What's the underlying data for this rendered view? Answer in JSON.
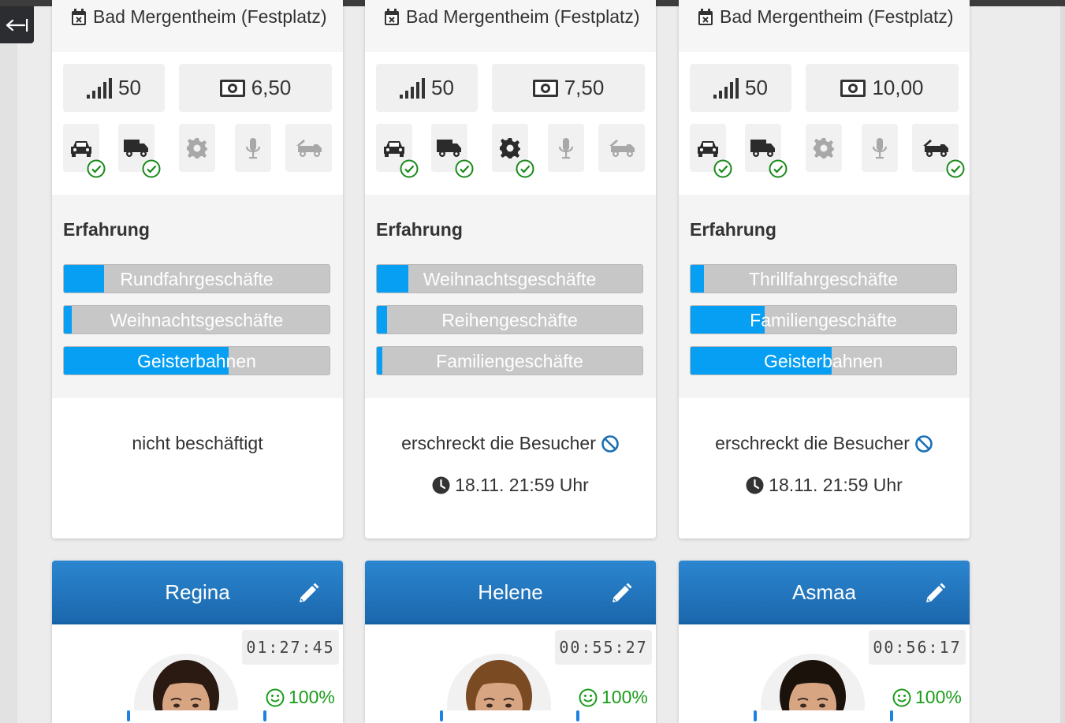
{
  "nav": {
    "back_icon": "arrow-left-bar-icon"
  },
  "cards": [
    {
      "location": "Bad Mergentheim (Festplatz)",
      "level": "50",
      "price": "6,50",
      "vehicles": {
        "car": true,
        "truck": true,
        "gear": false,
        "mic": false,
        "tow": false
      },
      "experience_title": "Erfahrung",
      "skills": [
        {
          "label": "Rundfahrgeschäfte",
          "level": 0.15
        },
        {
          "label": "Weihnachtsgeschäfte",
          "level": 0.03
        },
        {
          "label": "Geisterbahnen",
          "level": 0.62
        }
      ],
      "status": "nicht beschäftigt",
      "time": ""
    },
    {
      "location": "Bad Mergentheim (Festplatz)",
      "level": "50",
      "price": "7,50",
      "vehicles": {
        "car": true,
        "truck": true,
        "gear": true,
        "mic": false,
        "tow": false
      },
      "experience_title": "Erfahrung",
      "skills": [
        {
          "label": "Weihnachtsgeschäfte",
          "level": 0.12
        },
        {
          "label": "Reihengeschäfte",
          "level": 0.04
        },
        {
          "label": "Familiengeschäfte",
          "level": 0.02
        }
      ],
      "status": "erschreckt die Besucher",
      "time": "18.11. 21:59 Uhr"
    },
    {
      "location": "Bad Mergentheim (Festplatz)",
      "level": "50",
      "price": "10,00",
      "vehicles": {
        "car": true,
        "truck": true,
        "gear": false,
        "mic": false,
        "tow": true
      },
      "experience_title": "Erfahrung",
      "skills": [
        {
          "label": "Thrillfahrgeschäfte",
          "level": 0.05
        },
        {
          "label": "Familiengeschäfte",
          "level": 0.28
        },
        {
          "label": "Geisterbahnen",
          "level": 0.53
        }
      ],
      "status": "erschreckt die Besucher",
      "time": "18.11. 21:59 Uhr"
    }
  ],
  "people": [
    {
      "name": "Regina",
      "timer": "01:27:45",
      "mood": "100%"
    },
    {
      "name": "Helene",
      "timer": "00:55:27",
      "mood": "100%"
    },
    {
      "name": "Asmaa",
      "timer": "00:56:17",
      "mood": "100%"
    }
  ],
  "colors": {
    "accent": "#069ff3",
    "header_blue": "#1e6fb8",
    "success": "#1a9c1a",
    "ban": "#1a6fb5"
  }
}
